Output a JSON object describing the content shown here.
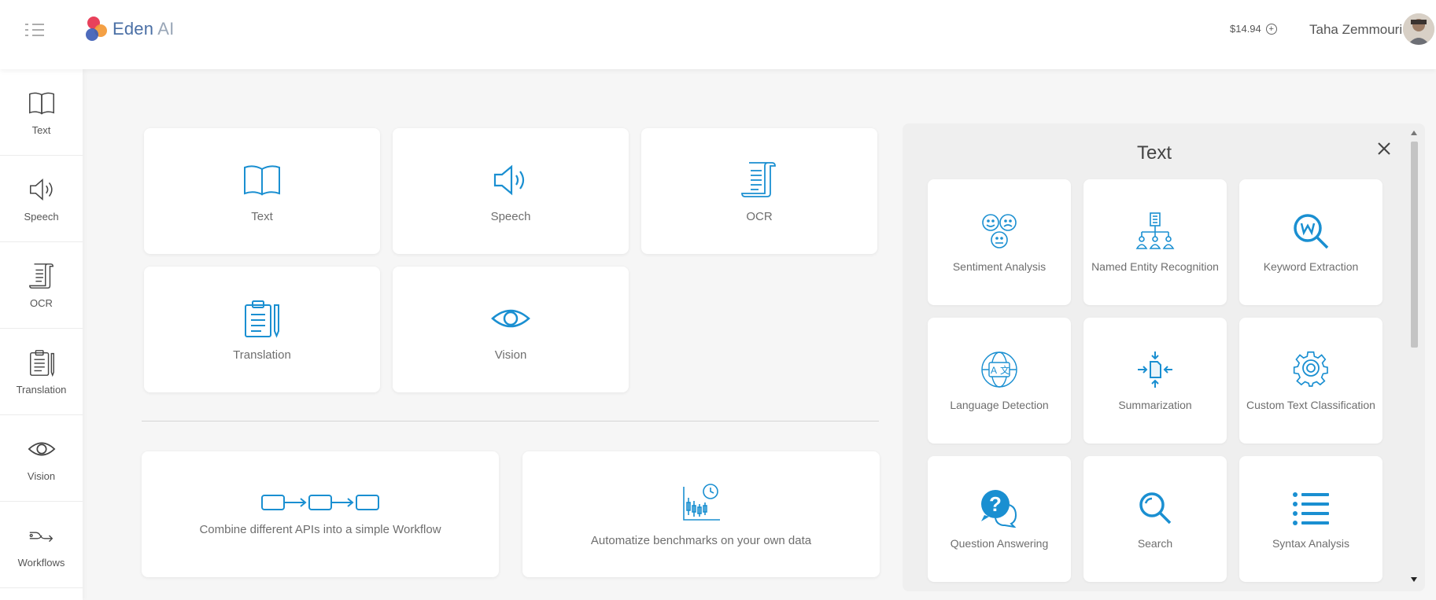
{
  "header": {
    "logo_text": "Eden",
    "logo_ai": "AI",
    "balance": "$14.94",
    "balance_add": "+",
    "username": "Taha Zemmouri"
  },
  "sidebar": {
    "items": [
      {
        "label": "Text"
      },
      {
        "label": "Speech"
      },
      {
        "label": "OCR"
      },
      {
        "label": "Translation"
      },
      {
        "label": "Vision"
      },
      {
        "label": "Workflows"
      }
    ]
  },
  "categories": [
    {
      "label": "Text"
    },
    {
      "label": "Speech"
    },
    {
      "label": "OCR"
    },
    {
      "label": "Translation"
    },
    {
      "label": "Vision"
    }
  ],
  "tools": {
    "workflow": "Combine different APIs into a simple Workflow",
    "benchmark": "Automatize benchmarks on your own data"
  },
  "panel": {
    "title": "Text",
    "features": [
      {
        "label": "Sentiment Analysis"
      },
      {
        "label": "Named Entity Recognition"
      },
      {
        "label": "Keyword Extraction"
      },
      {
        "label": "Language Detection"
      },
      {
        "label": "Summarization"
      },
      {
        "label": "Custom Text Classification"
      },
      {
        "label": "Question Answering"
      },
      {
        "label": "Search"
      },
      {
        "label": "Syntax Analysis"
      }
    ]
  },
  "colors": {
    "accent": "#1a8fd1",
    "sidebar_icon": "#444444"
  }
}
